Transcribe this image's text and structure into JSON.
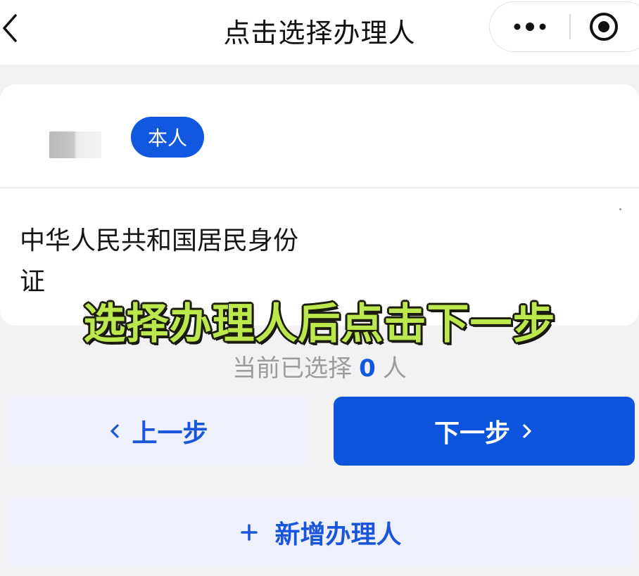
{
  "header": {
    "title": "点击选择办理人",
    "back_icon": "chevron-left-icon",
    "more_icon": "more-dots-icon",
    "target_icon": "target-icon"
  },
  "person": {
    "badge": "本人",
    "id_type": "中华人民共和国居民身份证"
  },
  "overlay": {
    "caption": "选择办理人后点击下一步"
  },
  "selection": {
    "prefix": "当前已选择",
    "count": "0",
    "suffix": "人"
  },
  "buttons": {
    "prev_label": "上一步",
    "next_label": "下一步",
    "add_label": "新增办理人"
  },
  "colors": {
    "accent": "#1257e0",
    "secondary_button_bg": "#eef0fb",
    "caption_fill": "#bde84d"
  }
}
